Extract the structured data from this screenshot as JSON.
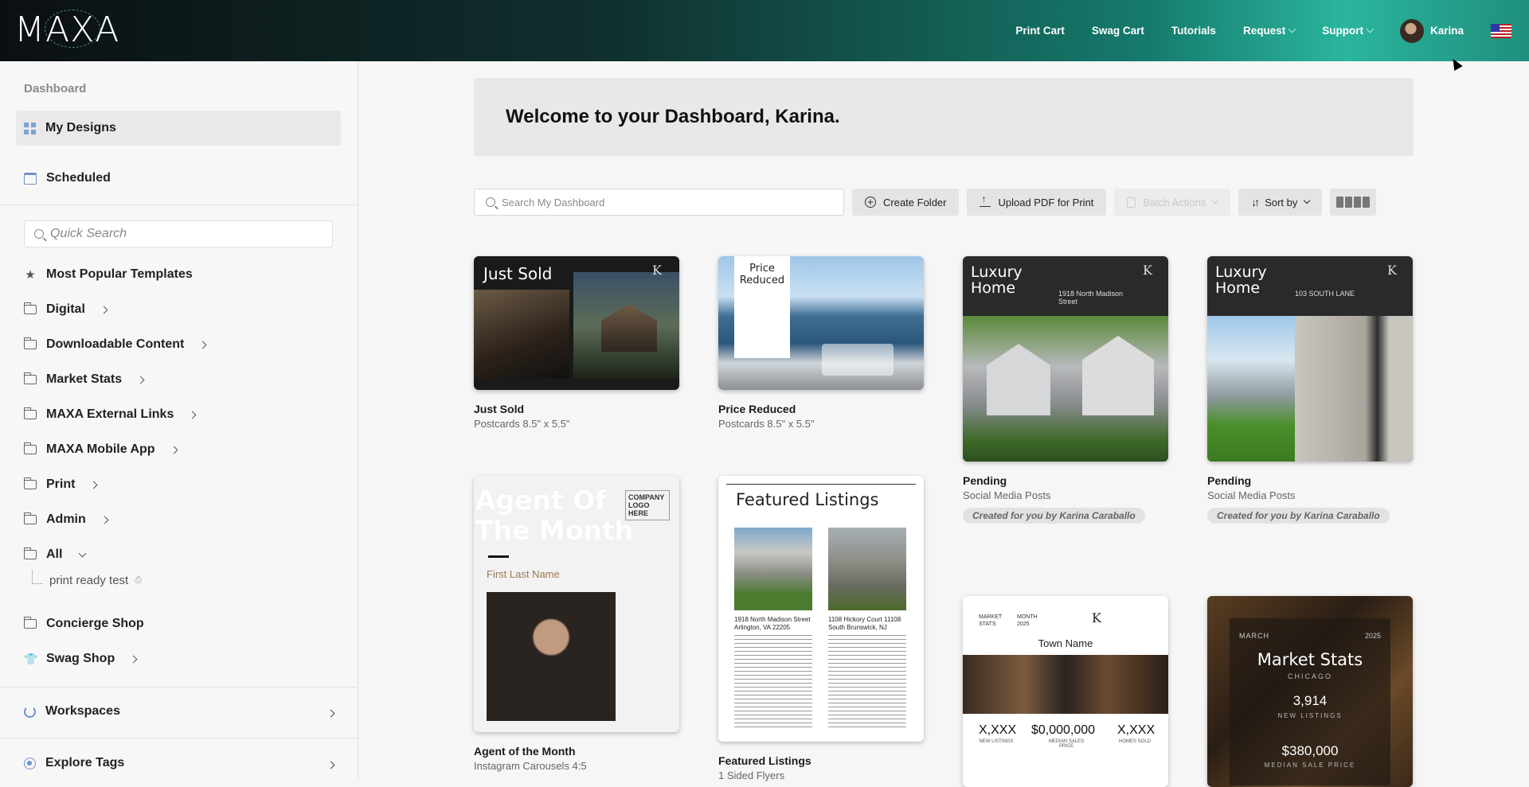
{
  "topbar": {
    "logo": "MAXA",
    "nav": [
      "Print Cart",
      "Swag Cart",
      "Tutorials",
      "Request",
      "Support"
    ],
    "user_name": "Karina"
  },
  "sidebar": {
    "section_label": "Dashboard",
    "active_item": "My Designs",
    "scheduled": "Scheduled",
    "quick_search_placeholder": "Quick Search",
    "items": [
      {
        "label": "Most Popular Templates"
      },
      {
        "label": "Digital"
      },
      {
        "label": "Downloadable Content"
      },
      {
        "label": "Market Stats"
      },
      {
        "label": "MAXA External Links"
      },
      {
        "label": "MAXA Mobile App"
      },
      {
        "label": "Print"
      },
      {
        "label": "Admin"
      },
      {
        "label": "All"
      },
      {
        "label": "Concierge Shop"
      },
      {
        "label": "Swag Shop"
      }
    ],
    "sub_item": "print ready test",
    "workspaces": "Workspaces",
    "explore_tags": "Explore Tags"
  },
  "main": {
    "welcome": "Welcome to your Dashboard, Karina.",
    "search_placeholder": "Search My Dashboard",
    "create_folder": "Create Folder",
    "upload_pdf": "Upload PDF for Print",
    "batch_actions": "Batch Actions",
    "sort_by": "Sort by",
    "cards": [
      {
        "title": "Just Sold",
        "subtitle": "Postcards 8.5\" x 5.5\"",
        "thumb_text": "Just Sold"
      },
      {
        "title": "Price Reduced",
        "subtitle": "Postcards 8.5\" x 5.5\"",
        "thumb_text": "Price Reduced"
      },
      {
        "title": "Pending",
        "subtitle": "Social Media Posts",
        "badge": "Created for you by Karina Caraballo",
        "thumb_text": "Luxury Home",
        "thumb_addr": "1918 North Madison Street"
      },
      {
        "title": "Pending",
        "subtitle": "Social Media Posts",
        "badge": "Created for you by Karina Caraballo",
        "thumb_text": "Luxury Home",
        "thumb_addr": "103 SOUTH LANE"
      },
      {
        "title": "Agent of the Month",
        "subtitle": "Instagram Carousels 4:5",
        "thumb_text": "Agent Of The Month",
        "thumb_logo": "COMPANY LOGO HERE",
        "thumb_name": "First Last Name"
      },
      {
        "title": "Featured Listings",
        "subtitle": "1 Sided Flyers",
        "thumb_text": "Featured Listings",
        "addr1": "1918 North Madison Street",
        "addr1b": "Arlington, VA 22205",
        "addr2": "1108 Hickory Court 11108",
        "addr2b": "South Brunswick, NJ"
      },
      {
        "title": "Town Name",
        "subtitle": "",
        "thumb_text": "Town Name",
        "stat1": "X,XXX",
        "stat2": "$0,000,000",
        "stat3": "X,XXX",
        "stat1_label": "NEW LISTINGS",
        "stat2_label": "MEDIAN SALES PRICE",
        "stat3_label": "HOMES SOLD",
        "header_left": "MARKET STATS",
        "header_mid": "MONTH 2025"
      },
      {
        "title": "Market Stats",
        "subtitle": "",
        "thumb_text": "Market Stats",
        "city": "CHICAGO",
        "month": "MARCH",
        "year": "2025",
        "stat1": "3,914",
        "stat1_label": "NEW LISTINGS",
        "stat2": "$380,000",
        "stat2_label": "MEDIAN SALE PRICE"
      }
    ]
  },
  "colors": {
    "topbar_start": "#0b0f12",
    "topbar_end": "#2bb59e",
    "accent_icon": "#6e93c9"
  }
}
